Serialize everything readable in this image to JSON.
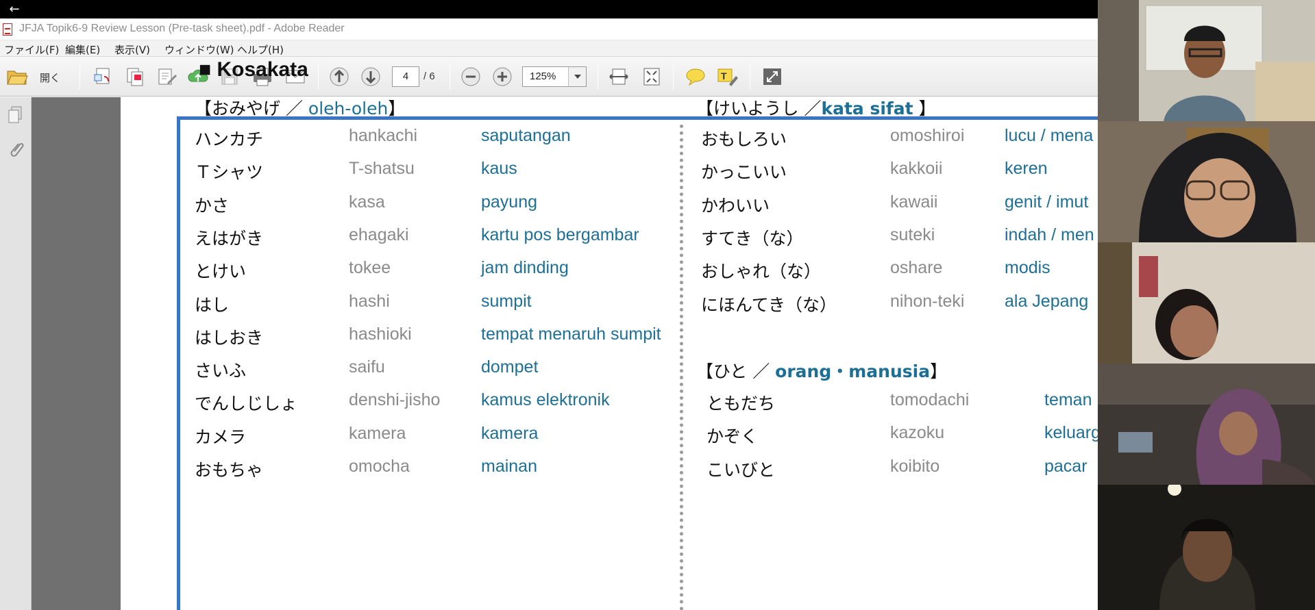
{
  "window_title": "JFJA Topik6-9 Review Lesson (Pre-task sheet).pdf - Adobe Reader",
  "menu": [
    "ファイル(F)",
    "編集(E)",
    "表示(V)",
    "ウィンドウ(W)",
    "ヘルプ(H)"
  ],
  "toolbar": {
    "open_label": "開く",
    "page_current": "4",
    "page_total": "/ 6",
    "zoom": "125%"
  },
  "document": {
    "title": "■ Kosakata",
    "left_section": {
      "heading_jp": "【おみやげ ／ ",
      "heading_id": "oleh-oleh",
      "heading_close": "】",
      "rows": [
        {
          "jp": "ハンカチ",
          "romaji": "hankachi",
          "id": "saputangan"
        },
        {
          "jp": "Ｔシャツ",
          "romaji": "T-shatsu",
          "id": "kaus"
        },
        {
          "jp": "かさ",
          "romaji": "kasa",
          "id": "payung"
        },
        {
          "jp": "えはがき",
          "romaji": "ehagaki",
          "id": "kartu pos bergambar"
        },
        {
          "jp": "とけい",
          "romaji": "tokee",
          "id": "jam dinding"
        },
        {
          "jp": "はし",
          "romaji": "hashi",
          "id": "sumpit"
        },
        {
          "jp": "はしおき",
          "romaji": "hashioki",
          "id": "tempat menaruh sumpit"
        },
        {
          "jp": "さいふ",
          "romaji": "saifu",
          "id": "dompet"
        },
        {
          "jp": "でんしじしょ",
          "romaji": "denshi-jisho",
          "id": "kamus elektronik"
        },
        {
          "jp": "カメラ",
          "romaji": "kamera",
          "id": "kamera"
        },
        {
          "jp": "おもちゃ",
          "romaji": "omocha",
          "id": "mainan"
        }
      ]
    },
    "right_section_1": {
      "heading_jp": "【けいようし ／",
      "heading_id": "kata sifat",
      "heading_close": " 】",
      "rows": [
        {
          "jp": "おもしろい",
          "romaji": "omoshiroi",
          "id": "lucu / mena"
        },
        {
          "jp": "かっこいい",
          "romaji": "kakkoii",
          "id": "keren"
        },
        {
          "jp": "かわいい",
          "romaji": "kawaii",
          "id": "genit / imut"
        },
        {
          "jp": "すてき（な）",
          "romaji": "suteki",
          "id": "indah / men"
        },
        {
          "jp": "おしゃれ（な）",
          "romaji": "oshare",
          "id": "modis"
        },
        {
          "jp": "にほんてき（な）",
          "romaji": "nihon-teki",
          "id": "ala Jepang"
        }
      ]
    },
    "right_section_2": {
      "heading_jp": "【ひと ／ ",
      "heading_id": "orang・manusia",
      "heading_close": "】",
      "rows": [
        {
          "jp": "ともだち",
          "romaji": "tomodachi",
          "id": "teman"
        },
        {
          "jp": "かぞく",
          "romaji": "kazoku",
          "id": "keluarg"
        },
        {
          "jp": "こいびと",
          "romaji": "koibito",
          "id": "pacar"
        }
      ]
    }
  },
  "colors": {
    "accent_blue": "#1d6f95",
    "frame_blue": "#3a74c6",
    "romaji_gray": "#8a8a8a"
  },
  "icons": [
    "back-arrow-icon",
    "pdf-file-icon",
    "open-folder-icon",
    "create-pdf-icon",
    "combine-icon",
    "edit-icon",
    "upload-icon",
    "save-icon",
    "print-icon",
    "email-icon",
    "previous-page-icon",
    "next-page-icon",
    "zoom-out-icon",
    "zoom-in-icon",
    "fit-width-icon",
    "fit-page-icon",
    "comment-icon",
    "highlight-icon",
    "fullscreen-icon",
    "pages-panel-icon",
    "attachments-icon"
  ],
  "participants": [
    "participant-1",
    "participant-2",
    "participant-3",
    "participant-4",
    "participant-5"
  ]
}
